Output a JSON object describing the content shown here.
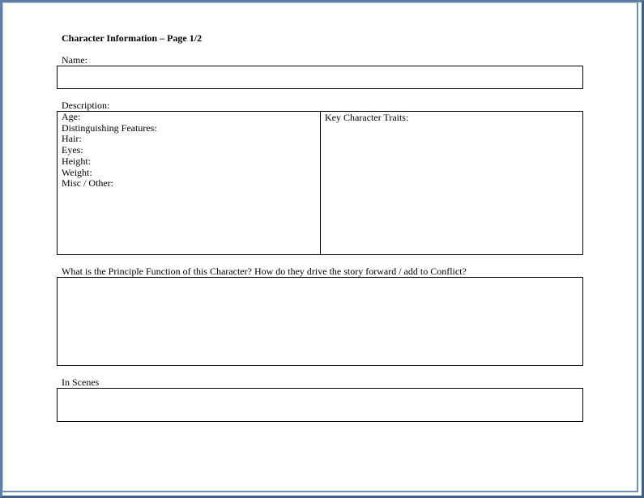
{
  "form": {
    "title": "Character Information – Page 1/2",
    "name_label": "Name:",
    "description_label": "Description:",
    "description_fields": [
      "Age:",
      "Distinguishing Features:",
      "Hair:",
      "Eyes:",
      "Height:",
      "Weight:",
      "Misc / Other:"
    ],
    "traits_label": "Key Character Traits:",
    "function_question": "What is the Principle Function of this Character? How do they drive the story forward / add to Conflict?",
    "scenes_label": "In Scenes"
  }
}
